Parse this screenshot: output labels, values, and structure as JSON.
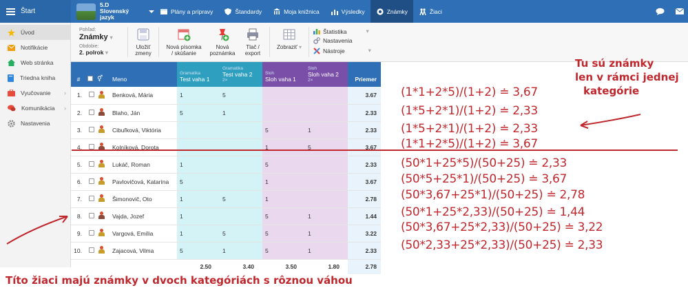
{
  "topbar": {
    "start_label": "Štart",
    "class_code": "5.D",
    "class_subject": "Slovenský jazyk",
    "nav": [
      {
        "label": "Plány a prípravy",
        "icon": "calendar-icon"
      },
      {
        "label": "Štandardy",
        "icon": "shield-icon"
      },
      {
        "label": "Moja knižnica",
        "icon": "library-icon"
      },
      {
        "label": "Výsledky",
        "icon": "bar-chart-icon"
      },
      {
        "label": "Známky",
        "icon": "grade-icon"
      },
      {
        "label": "Žiaci",
        "icon": "students-icon"
      }
    ],
    "active_nav": "Známky"
  },
  "sidebar": {
    "items": [
      {
        "label": "Úvod",
        "icon": "star-icon",
        "color": "#f5b800"
      },
      {
        "label": "Notifikácie",
        "icon": "mail-icon",
        "color": "#f39c12"
      },
      {
        "label": "Web stránka",
        "icon": "home-icon",
        "color": "#27ae60"
      },
      {
        "label": "Triedna kniha",
        "icon": "book-icon",
        "color": "#2e86de"
      },
      {
        "label": "Vyučovanie",
        "icon": "briefcase-icon",
        "color": "#e74c3c"
      },
      {
        "label": "Komunikácia",
        "icon": "chat-icon",
        "color": "#e74c3c"
      },
      {
        "label": "Nastavenia",
        "icon": "gear-icon",
        "color": "#888888"
      }
    ]
  },
  "toolbar": {
    "view_label": "Pohľad:",
    "view_value": "Známky",
    "period_label": "Obdobie:",
    "period_value": "2. polrok",
    "save_line1": "Uložiť",
    "save_line2": "zmeny",
    "new_test_line1": "Nová písomka",
    "new_test_line2": "/ skúšanie",
    "new_note_line1": "Nová",
    "new_note_line2": "poznámka",
    "print_line1": "Tlač /",
    "print_line2": "export",
    "show_label": "Zobraziť",
    "stats_label": "Štatistika",
    "settings_label": "Nastavenia",
    "tools_label": "Nástroje"
  },
  "table": {
    "headers": {
      "num": "#",
      "name": "Meno",
      "col1_cat": "Gramatika",
      "col1_title": "Test vaha 1",
      "col2_cat": "Gramatika",
      "col2_title": "Test vaha 2",
      "col2_weight": "2×",
      "col3_cat": "Sloh",
      "col3_title": "Sloh vaha 1",
      "col4_cat": "Sloh",
      "col4_title": "Sloh vaha 2",
      "col4_weight": "2×",
      "avg": "Priemer"
    },
    "rows": [
      {
        "n": "1.",
        "name": "Benková, Mária",
        "g1": "1",
        "g2": "5",
        "s1": "",
        "s2": "",
        "avg": "3.67",
        "gender": "f"
      },
      {
        "n": "2.",
        "name": "Blaho, Ján",
        "g1": "5",
        "g2": "1",
        "s1": "",
        "s2": "",
        "avg": "2.33",
        "gender": "m"
      },
      {
        "n": "3.",
        "name": "Cibuľková, Viktória",
        "g1": "",
        "g2": "",
        "s1": "5",
        "s2": "1",
        "avg": "2.33",
        "gender": "f"
      },
      {
        "n": "4.",
        "name": "Kolníková, Dorota",
        "g1": "",
        "g2": "",
        "s1": "1",
        "s2": "5",
        "avg": "3.67",
        "gender": "m"
      },
      {
        "n": "5.",
        "name": "Lukáč, Roman",
        "g1": "1",
        "g2": "",
        "s1": "5",
        "s2": "",
        "avg": "2.33",
        "gender": "f"
      },
      {
        "n": "6.",
        "name": "Pavlovičová, Katarína",
        "g1": "5",
        "g2": "",
        "s1": "1",
        "s2": "",
        "avg": "3.67",
        "gender": "f"
      },
      {
        "n": "7.",
        "name": "Šimonovič, Oto",
        "g1": "1",
        "g2": "5",
        "s1": "1",
        "s2": "",
        "avg": "2.78",
        "gender": "f"
      },
      {
        "n": "8.",
        "name": "Vajda, Jozef",
        "g1": "1",
        "g2": "",
        "s1": "5",
        "s2": "1",
        "avg": "1.44",
        "gender": "m"
      },
      {
        "n": "9.",
        "name": "Vargová, Emília",
        "g1": "1",
        "g2": "5",
        "s1": "5",
        "s2": "1",
        "avg": "3.22",
        "gender": "f"
      },
      {
        "n": "10.",
        "name": "Zajacová, Vilma",
        "g1": "5",
        "g2": "1",
        "s1": "5",
        "s2": "1",
        "avg": "2.33",
        "gender": "f"
      }
    ],
    "totals": {
      "g1": "2.50",
      "g2": "3.40",
      "s1": "3.50",
      "s2": "1.80",
      "avg": "2.78"
    }
  },
  "annotations": {
    "note_right_1": "Tu sú známky",
    "note_right_2": "len v rámci jednej",
    "note_right_3": "kategórie",
    "note_bottom": "Títo žiaci majú známky v dvoch kategóriách s rôznou váhou",
    "formulas": [
      "(1*1+2*5)/(1+2) ≐ 3,67",
      "(1*5+2*1)/(1+2) ≐ 2,33",
      "(1*5+2*1)/(1+2) ≐ 2,33",
      "(1*1+2*5)/(1+2) ≐ 3,67",
      "(50*1+25*5)/(50+25) ≐ 2,33",
      "(50*5+25*1)/(50+25) ≐ 3,67",
      "(50*3,67+25*1)/(50+25) ≐ 2,78",
      "(50*1+25*2,33)/(50+25) ≐ 1,44",
      "(50*3,67+25*2,33)/(50+25) ≐ 3,22",
      "(50*2,33+25*2,33)/(50+25) ≐ 2,33"
    ],
    "color": "#c0272d"
  }
}
